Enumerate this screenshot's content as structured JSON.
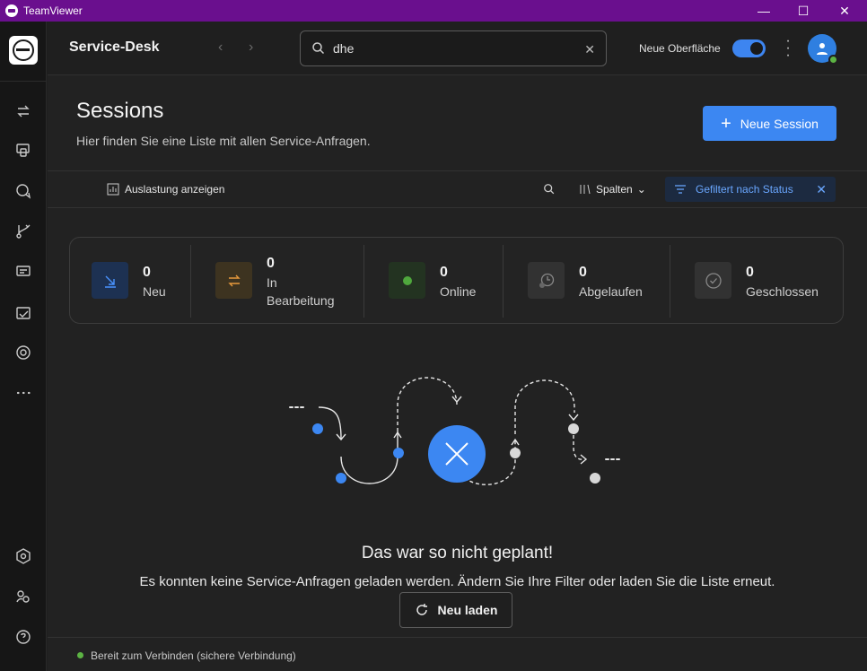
{
  "window": {
    "app_name": "TeamViewer",
    "minimize": "—",
    "maximize": "☐",
    "close": "✕"
  },
  "header": {
    "title": "Service-Desk",
    "search_value": "dhe",
    "ui_toggle_label": "Neue Oberfläche",
    "ui_toggle_on": true
  },
  "page": {
    "title": "Sessions",
    "subtitle": "Hier finden Sie eine Liste mit allen Service-Anfragen.",
    "new_session_label": "Neue Session"
  },
  "toolbar": {
    "utilization_label": "Auslastung anzeigen",
    "columns_label": "Spalten",
    "filter_label": "Gefiltert nach Status"
  },
  "stats": [
    {
      "count": "0",
      "label": "Neu",
      "color": "#1d3152",
      "icon": "arrow-down-right-icon"
    },
    {
      "count": "0",
      "label": "In Bearbeitung",
      "color": "#3d3320",
      "icon": "swap-icon"
    },
    {
      "count": "0",
      "label": "Online",
      "color": "#233321",
      "icon": "online-dot-icon"
    },
    {
      "count": "0",
      "label": "Abgelaufen",
      "color": "#323232",
      "icon": "expired-clock-icon"
    },
    {
      "count": "0",
      "label": "Geschlossen",
      "color": "#323232",
      "icon": "check-circle-icon"
    }
  ],
  "empty_state": {
    "title": "Das war so nicht geplant!",
    "message": "Es konnten keine Service-Anfragen geladen werden. Ändern Sie Ihre Filter oder laden Sie die Liste erneut.",
    "reload_label": "Neu laden"
  },
  "status": {
    "text": "Bereit zum Verbinden (sichere Verbindung)",
    "color": "#5cb343"
  },
  "colors": {
    "accent": "#3c87f2",
    "titlebar": "#6a0f8e"
  }
}
